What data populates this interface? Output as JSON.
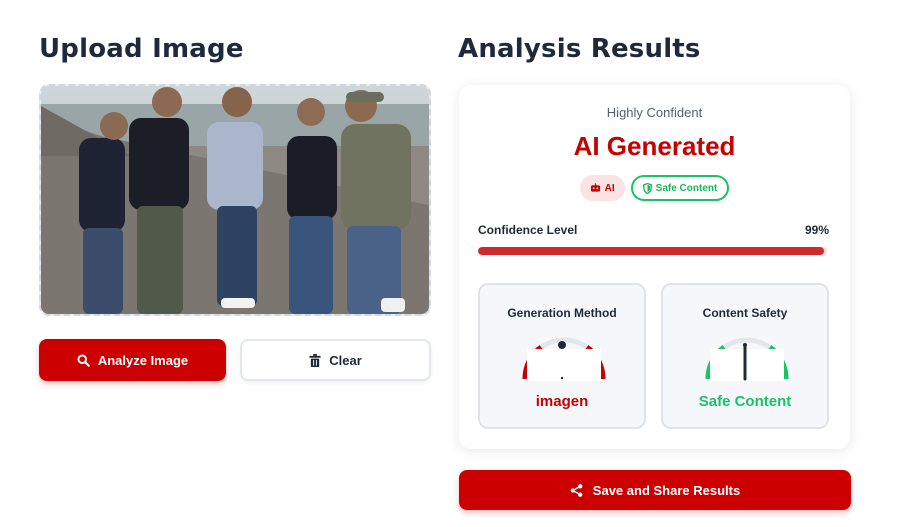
{
  "upload": {
    "title": "Upload Image",
    "analyze_label": "Analyze Image",
    "clear_label": "Clear"
  },
  "results": {
    "title": "Analysis Results",
    "confidence_text": "Highly Confident",
    "verdict": "AI Generated",
    "badge_ai": "AI",
    "badge_safe": "Safe Content",
    "confidence_label": "Confidence Level",
    "confidence_value": "99%",
    "confidence_fraction": 0.99,
    "method_title": "Generation Method",
    "method_value": "imagen",
    "safety_title": "Content Safety",
    "safety_value": "Safe Content",
    "share_label": "Save and Share Results"
  },
  "colors": {
    "accent": "#cc0000",
    "safe": "#19c463",
    "text": "#1e2a3b"
  },
  "icons": {
    "analyze": "search-icon",
    "clear": "trash-icon",
    "badge_ai": "robot-icon",
    "badge_safe": "shield-icon",
    "share": "share-icon"
  }
}
